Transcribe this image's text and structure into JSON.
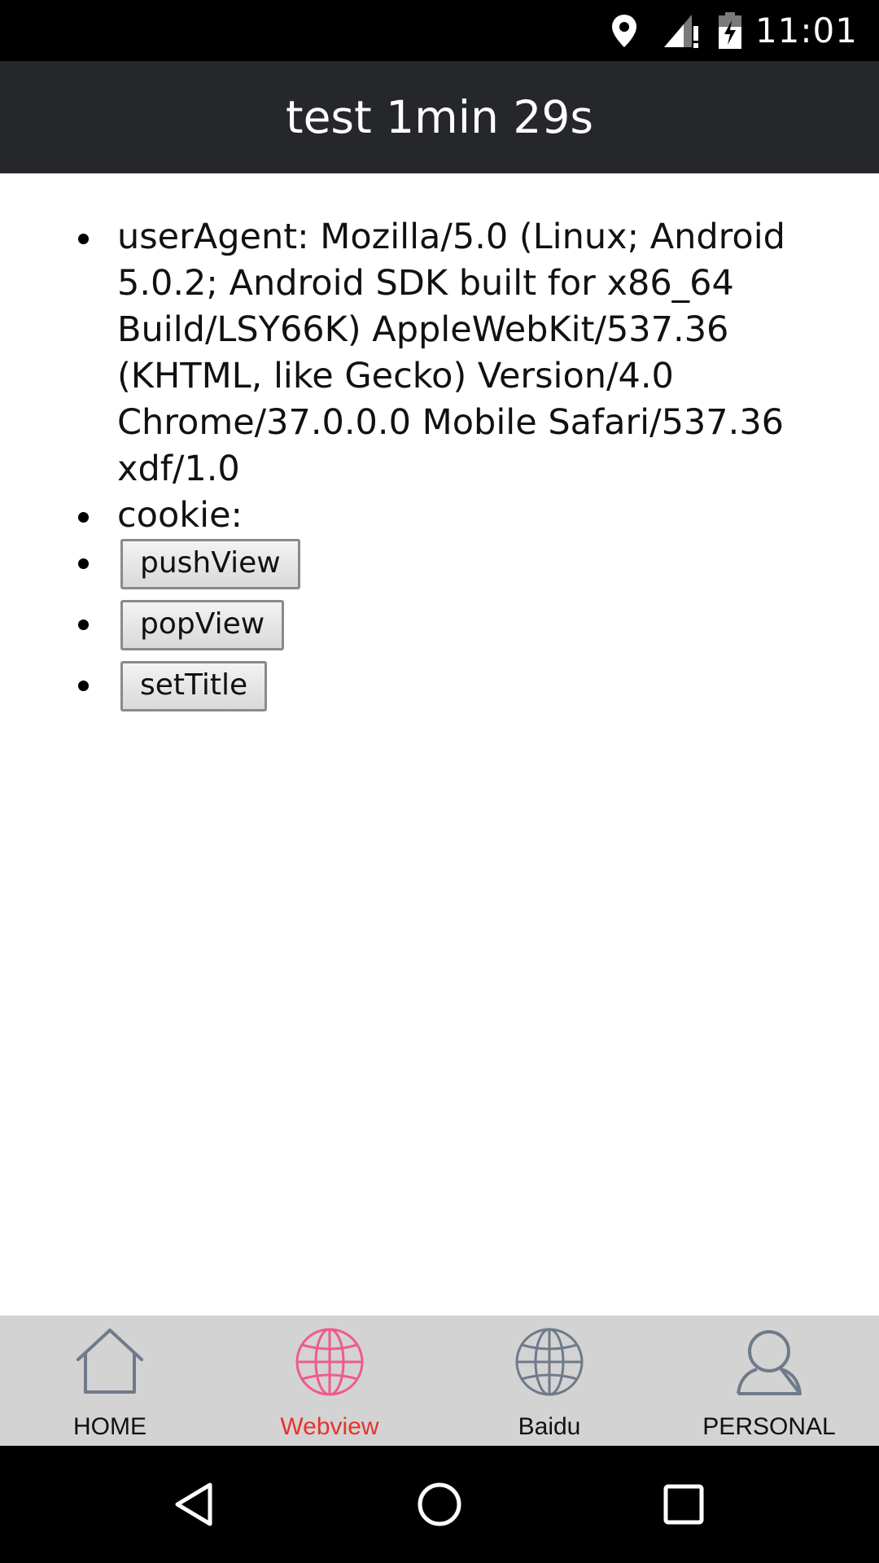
{
  "status_bar": {
    "time": "11:01",
    "icons": [
      "location-icon",
      "signal-icon",
      "battery-icon"
    ]
  },
  "header": {
    "title": "test 1min 29s"
  },
  "main": {
    "user_agent_text": "userAgent: Mozilla/5.0 (Linux; Android 5.0.2; Android SDK built for x86_64 Build/LSY66K) AppleWebKit/537.36 (KHTML, like Gecko) Version/4.0 Chrome/37.0.0.0 Mobile Safari/537.36 xdf/1.0",
    "cookie_text": "cookie:",
    "buttons": {
      "push_view": "pushView",
      "pop_view": "popView",
      "set_title": "setTitle"
    }
  },
  "tab_bar": {
    "tabs": [
      {
        "label": "HOME",
        "icon": "home-icon",
        "active": false
      },
      {
        "label": "Webview",
        "icon": "globe-icon",
        "active": true
      },
      {
        "label": "Baidu",
        "icon": "globe-icon",
        "active": false
      },
      {
        "label": "PERSONAL",
        "icon": "person-icon",
        "active": false
      }
    ],
    "active_color": "#e8322d",
    "active_icon_color": "#ef5b8c",
    "inactive_icon_color": "#6f7a8a"
  },
  "nav_bar": {
    "icons": [
      "back-icon",
      "home-circle-icon",
      "recents-icon"
    ]
  }
}
